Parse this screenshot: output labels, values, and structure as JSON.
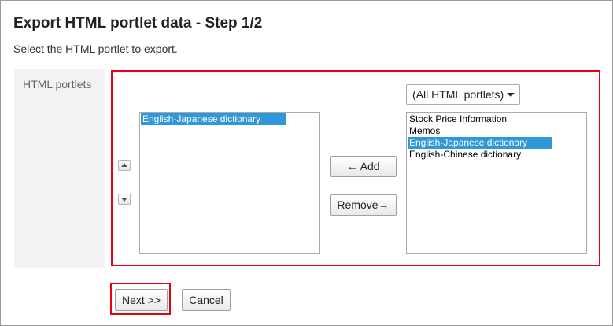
{
  "page": {
    "title": "Export HTML portlet data - Step 1/2",
    "subtitle": "Select the HTML portlet to export."
  },
  "form": {
    "field_label": "HTML portlets",
    "selected_list": {
      "items": [
        {
          "label": "English-Japanese dictionary",
          "selected": true
        }
      ]
    },
    "filter_select": {
      "value": "(All HTML portlets)"
    },
    "available_list": {
      "items": [
        {
          "label": "Stock Price Information",
          "selected": false
        },
        {
          "label": "Memos",
          "selected": false
        },
        {
          "label": "English-Japanese dictionary",
          "selected": true
        },
        {
          "label": "English-Chinese dictionary",
          "selected": false
        }
      ]
    },
    "add_label": "← Add",
    "remove_label": "Remove→"
  },
  "actions": {
    "next_label": "Next >>",
    "cancel_label": "Cancel"
  },
  "colors": {
    "highlight_border": "#e60012",
    "selection_bg": "#2f98d6",
    "label_bg": "#f2f2f2"
  }
}
